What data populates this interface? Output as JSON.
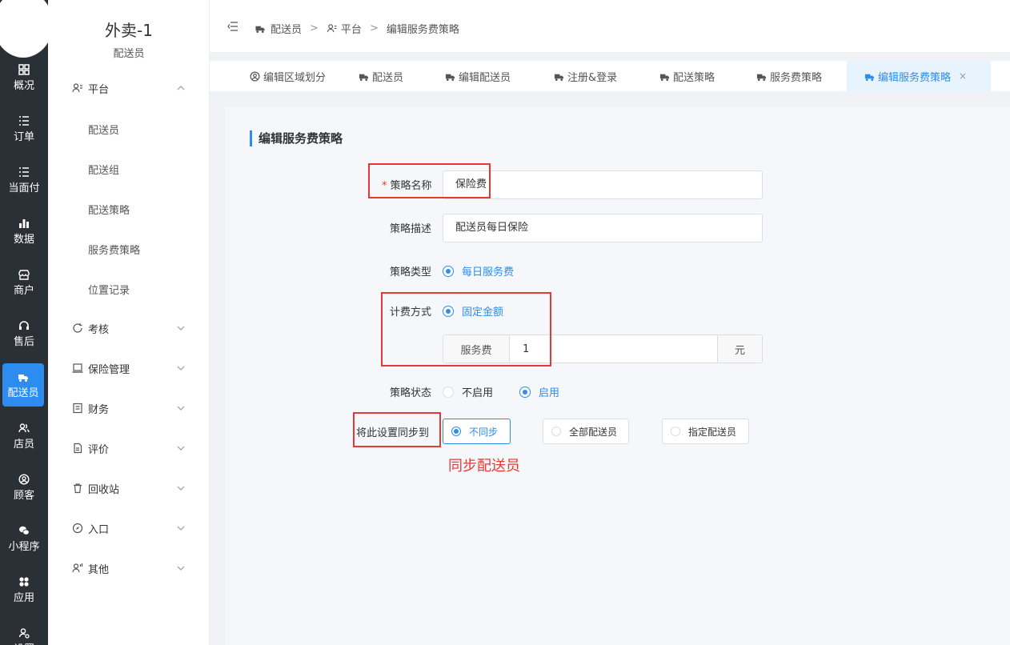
{
  "rail": {
    "items": [
      {
        "label": "概况",
        "icon": "overview-icon"
      },
      {
        "label": "订单",
        "icon": "list-icon"
      },
      {
        "label": "当面付",
        "icon": "list-icon"
      },
      {
        "label": "数据",
        "icon": "bar-chart-icon"
      },
      {
        "label": "商户",
        "icon": "store-icon"
      },
      {
        "label": "售后",
        "icon": "headset-icon"
      },
      {
        "label": "配送员",
        "icon": "delivery-icon"
      },
      {
        "label": "店员",
        "icon": "users-icon"
      },
      {
        "label": "顾客",
        "icon": "user-circle-icon"
      },
      {
        "label": "小程序",
        "icon": "wechat-icon"
      },
      {
        "label": "应用",
        "icon": "apps-icon"
      },
      {
        "label": "设置",
        "icon": "user-gear-icon"
      }
    ]
  },
  "sidebar": {
    "title": "外卖-1",
    "subtitle": "配送员",
    "groups": [
      {
        "label": "平台"
      },
      {
        "label": "考核"
      },
      {
        "label": "保险管理"
      },
      {
        "label": "财务"
      },
      {
        "label": "评价"
      },
      {
        "label": "回收站"
      },
      {
        "label": "入口"
      },
      {
        "label": "其他"
      }
    ],
    "sub_items": [
      "配送员",
      "配送组",
      "配送策略",
      "服务费策略",
      "位置记录"
    ]
  },
  "breadcrumb": {
    "items": [
      "配送员",
      "平台",
      "编辑服务费策略"
    ],
    "sep": ">"
  },
  "tabs": [
    {
      "label": "编辑区域划分"
    },
    {
      "label": "配送员"
    },
    {
      "label": "编辑配送员"
    },
    {
      "label": "注册&登录"
    },
    {
      "label": "配送策略"
    },
    {
      "label": "服务费策略"
    },
    {
      "label": "编辑服务费策略"
    }
  ],
  "tab_close": "×",
  "form": {
    "title": "编辑服务费策略",
    "name_label": "策略名称",
    "name_required": "*",
    "name_value": "保险费",
    "desc_label": "策略描述",
    "desc_value": "配送员每日保险",
    "type_label": "策略类型",
    "type_option": "每日服务费",
    "billing_label": "计费方式",
    "billing_option": "固定金额",
    "fee_prefix": "服务费",
    "fee_value": "1",
    "fee_suffix": "元",
    "status_label": "策略状态",
    "status_off": "不启用",
    "status_on": "启用",
    "sync_label": "将此设置同步到",
    "sync_options": [
      "不同步",
      "全部配送员",
      "指定配送员"
    ]
  },
  "annotation": "同步配送员",
  "colors": {
    "accent": "#2d8cf0",
    "highlight": "#e53935",
    "rail": "#2b2f36"
  }
}
